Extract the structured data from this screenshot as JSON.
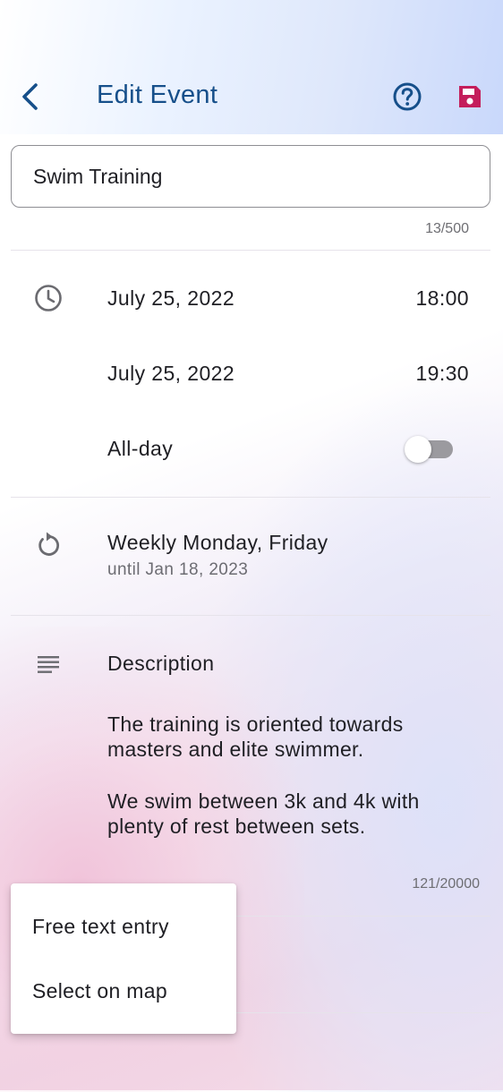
{
  "header": {
    "title": "Edit Event",
    "back_icon": "chevron-left-icon",
    "help_icon": "help-circle-icon",
    "save_icon": "save-icon",
    "accent_color": "#164f8a",
    "save_color": "#c41e5b"
  },
  "title_field": {
    "value": "Swim Training",
    "counter": "13/500"
  },
  "schedule": {
    "icon": "clock-icon",
    "start_date": "July 25, 2022",
    "start_time": "18:00",
    "end_date": "July 25, 2022",
    "end_time": "19:30",
    "all_day_label": "All-day",
    "all_day_on": false
  },
  "recurrence": {
    "icon": "repeat-icon",
    "rule": "Weekly Monday, Friday",
    "until": "until Jan 18, 2023"
  },
  "description": {
    "icon": "notes-icon",
    "label": "Description",
    "paragraph1": "The training is oriented towards masters and elite swimmer.",
    "paragraph2": "We swim between 3k and 4k with plenty of rest between sets.",
    "counter": "121/20000"
  },
  "location_menu": {
    "items": [
      "Free text entry",
      "Select on map"
    ]
  }
}
